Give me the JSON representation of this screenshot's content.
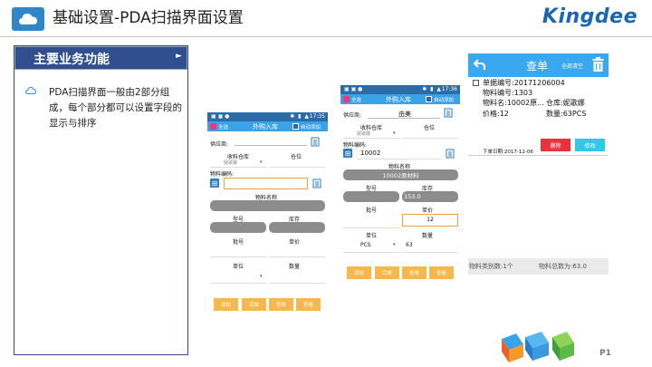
{
  "header": {
    "title": "基础设置-PDA扫描界面设置",
    "brand": "Kingdee",
    "page_number": "P1"
  },
  "left_panel": {
    "heading": "主要业务功能",
    "body": "PDA扫描界面一般由2部分组成，每个部分都可以设置字段的显示与排序"
  },
  "screen1": {
    "status_time": "17:35",
    "left_check": "全选",
    "title": "外购入库",
    "right_check": "自动添加",
    "supplier_label": "供应商:",
    "warehouse_label": "收料仓库",
    "location_label": "仓位",
    "warehouse_value": "妮歌娜",
    "material_code_label": "物料编码:",
    "material_name_label": "物料名称",
    "model_label": "型号",
    "stock_label": "库存",
    "batch_label": "批号",
    "price_label": "单价",
    "unit_label": "单位",
    "qty_label": "数量",
    "buttons": [
      "添加",
      "完单",
      "查单",
      "查看"
    ]
  },
  "screen2": {
    "status_time": "17:36",
    "left_check": "全选",
    "title": "外购入库",
    "right_check": "自动添加",
    "supplier_label": "供应商:",
    "supplier_value": "由美",
    "warehouse_label": "收料仓库",
    "location_label": "仓位",
    "warehouse_value": "妮歌娜",
    "material_code_label": "物料编码:",
    "material_code_value": "10002",
    "material_name_label": "物料名称",
    "material_name_value": "10002原材料",
    "model_label": "型号",
    "stock_label": "库存",
    "stock_value": "153.0",
    "batch_label": "批号",
    "price_label": "单价",
    "price_value": "12",
    "unit_label": "单位",
    "qty_label": "数量",
    "unit_value": "PCS",
    "qty_value": "63",
    "buttons": [
      "添加",
      "完单",
      "查单",
      "查看"
    ]
  },
  "screen3": {
    "title": "查单",
    "clear_label": "全部清空",
    "order_no": "单据编号:20171206004",
    "material_code": "物料编号:1303",
    "material_name": "物料名:10002原...",
    "warehouse": "仓库:妮歌娜",
    "price": "价格:12",
    "qty": "数量:63PCS",
    "date": "下单日期:2017-12-06",
    "delete_label": "删除",
    "edit_label": "修改",
    "type_count": "物料类别数:1个",
    "total_count": "物料总数为:63.0"
  },
  "colors": {
    "header_blue": "#2f4f8f",
    "app_blue": "#3aa3e8",
    "orange": "#f6b849",
    "delete_red": "#e8323c",
    "edit_cyan": "#32c8e6"
  }
}
